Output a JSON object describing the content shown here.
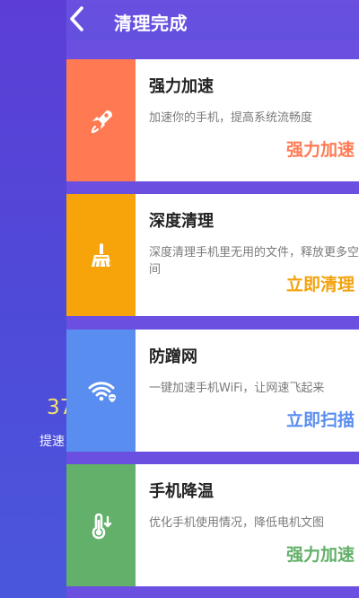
{
  "app": {
    "title": "清理完成"
  },
  "background": {
    "metric_partial": "37",
    "subtitle_partial": "提速"
  },
  "cards": [
    {
      "title": "强力加速",
      "description": "加速你的手机，提高系统流畅度",
      "action": "强力加速",
      "icon": "rocket-icon",
      "color": "#ff7a52"
    },
    {
      "title": "深度清理",
      "description": "深度清理手机里无用的文件，释放更多空间",
      "action": "立即清理",
      "icon": "broom-icon",
      "color": "#f6a40a"
    },
    {
      "title": "防蹭网",
      "description": "一键加速手机WiFi，让网速飞起来",
      "action": "立即扫描",
      "icon": "wifi-shield-icon",
      "color": "#5a8df0"
    },
    {
      "title": "手机降温",
      "description": "优化手机使用情况，降低电机文图",
      "action": "强力加速",
      "icon": "thermometer-icon",
      "color": "#62b069"
    }
  ]
}
